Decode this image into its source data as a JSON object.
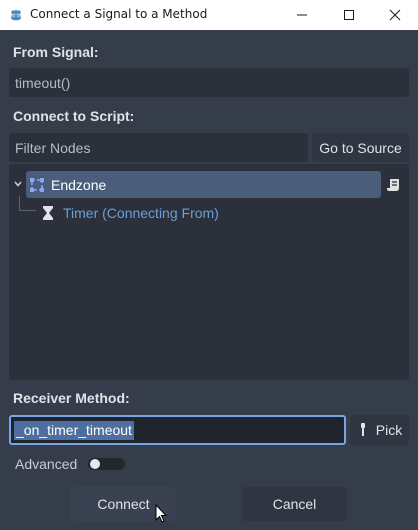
{
  "window": {
    "title": "Connect a Signal to a Method"
  },
  "from_signal": {
    "label": "From Signal:",
    "value": "timeout()"
  },
  "connect_to_script": {
    "label": "Connect to Script:",
    "filter_placeholder": "Filter Nodes",
    "go_to_source_label": "Go to Source"
  },
  "tree": {
    "nodes": [
      {
        "name": "Endzone",
        "icon": "area2d-icon",
        "selected": true,
        "has_script": true
      },
      {
        "name": "Timer (Connecting From)",
        "icon": "hourglass-icon",
        "selected": false
      }
    ]
  },
  "receiver_method": {
    "label": "Receiver Method:",
    "value": "_on_timer_timeout",
    "pick_label": "Pick"
  },
  "advanced": {
    "label": "Advanced",
    "enabled": false
  },
  "actions": {
    "connect_label": "Connect",
    "cancel_label": "Cancel"
  },
  "colors": {
    "background": "#363d4a",
    "field": "#2b303a",
    "selection": "#4a5e7b",
    "accent": "#78a6e4",
    "link_text": "#6a9fd9"
  }
}
